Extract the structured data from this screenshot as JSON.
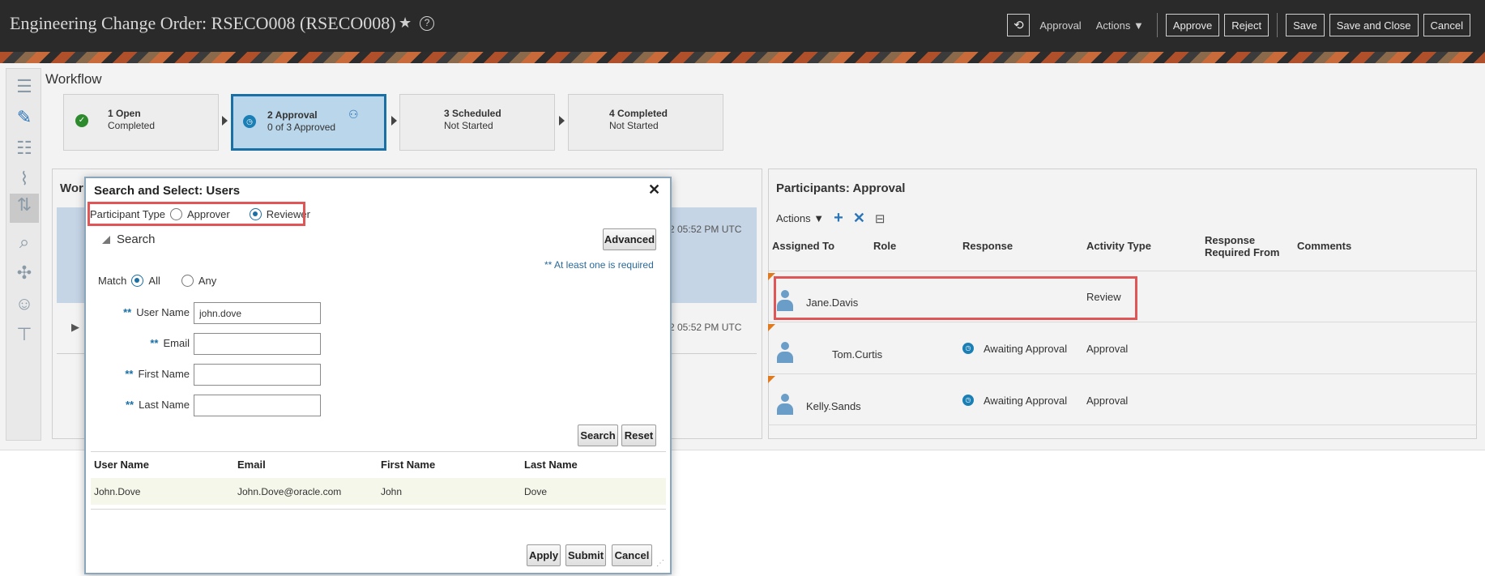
{
  "header": {
    "title": "Engineering Change Order: RSECO008 (RSECO008)",
    "status_label": "Approval",
    "actions_label": "Actions",
    "approve": "Approve",
    "reject": "Reject",
    "save": "Save",
    "save_close": "Save and Close",
    "cancel": "Cancel"
  },
  "workflow": {
    "title": "Workflow",
    "steps": [
      {
        "title": "1 Open",
        "sub": "Completed"
      },
      {
        "title": "2 Approval",
        "sub": "0 of 3 Approved"
      },
      {
        "title": "3 Scheduled",
        "sub": "Not Started"
      },
      {
        "title": "4 Completed",
        "sub": "Not Started"
      }
    ]
  },
  "work_panel": {
    "title": "Wor",
    "time1": "2 05:52 PM UTC",
    "time2": "2 05:52 PM UTC"
  },
  "participants": {
    "title": "Participants: Approval",
    "actions_label": "Actions",
    "columns": [
      "Assigned To",
      "Role",
      "Response",
      "Activity Type",
      "Response",
      "Required From",
      "Comments"
    ],
    "rows": [
      {
        "name": "Jane.Davis",
        "response": "",
        "activity": "Review"
      },
      {
        "name": "Tom.Curtis",
        "response": "Awaiting Approval",
        "activity": "Approval"
      },
      {
        "name": "Kelly.Sands",
        "response": "Awaiting Approval",
        "activity": "Approval"
      }
    ]
  },
  "dialog": {
    "title": "Search and Select: Users",
    "participant_type_label": "Participant Type",
    "approver": "Approver",
    "reviewer": "Reviewer",
    "search_header": "Search",
    "advanced": "Advanced",
    "required_note": "** At least one is required",
    "match_label": "Match",
    "match_all": "All",
    "match_any": "Any",
    "stars": "**",
    "fields": {
      "user_name_label": "User Name",
      "user_name_value": "john.dove",
      "email_label": "Email",
      "email_value": "",
      "first_name_label": "First Name",
      "first_name_value": "",
      "last_name_label": "Last Name",
      "last_name_value": ""
    },
    "search_btn": "Search",
    "reset_btn": "Reset",
    "results": {
      "headers": [
        "User Name",
        "Email",
        "First Name",
        "Last Name"
      ],
      "rows": [
        [
          "John.Dove",
          "John.Dove@oracle.com",
          "John",
          "Dove"
        ]
      ]
    },
    "apply": "Apply",
    "submit": "Submit",
    "cancel": "Cancel"
  },
  "icons": {
    "star": "star-icon",
    "help": "help-icon",
    "refresh": "refresh-icon",
    "close": "close-icon"
  },
  "colors": {
    "header_bg": "#2a2a2a",
    "accent": "#1a6fa5",
    "highlight": "#e05656",
    "current_step_bg": "#b9d6ea"
  }
}
